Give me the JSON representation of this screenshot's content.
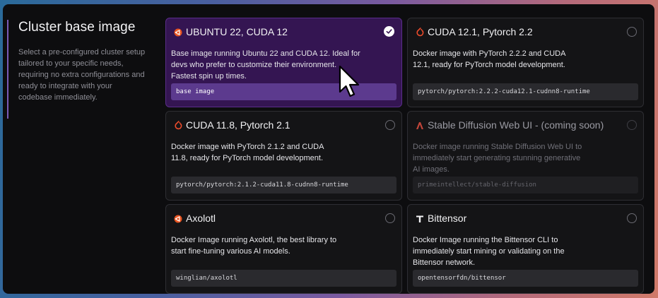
{
  "section": {
    "title": "Cluster base image",
    "description": "Select a pre-configured cluster setup tailored to your specific needs, requiring no extra configurations and ready to integrate with your codebase immediately."
  },
  "cards": [
    {
      "title": "UBUNTU 22, CUDA 12",
      "description": "Base image running Ubuntu 22 and CUDA 12. Ideal for devs who prefer to customize their environment. Fastest spin up times.",
      "tag": "base image",
      "icon": "ubuntu-icon",
      "state": "selected"
    },
    {
      "title": "CUDA 12.1, Pytorch 2.2",
      "description": "Docker image with PyTorch 2.2.2 and CUDA 12.1, ready for PyTorch model development.",
      "tag": "pytorch/pytorch:2.2.2-cuda12.1-cudnn8-runtime",
      "icon": "pytorch-icon",
      "state": "unselected"
    },
    {
      "title": "CUDA 11.8, Pytorch 2.1",
      "description": "Docker image with PyTorch 2.1.2 and CUDA 11.8, ready for PyTorch model development.",
      "tag": "pytorch/pytorch:2.1.2-cuda11.8-cudnn8-runtime",
      "icon": "pytorch-icon",
      "state": "unselected"
    },
    {
      "title": "Stable Diffusion Web UI - (coming soon)",
      "description": "Docker image running Stable Diffusion Web UI to immediately start generating stunning generative AI images.",
      "tag": "primeintellect/stable-diffusion",
      "icon": "stable-diffusion-icon",
      "state": "disabled"
    },
    {
      "title": "Axolotl",
      "description": "Docker Image running Axolotl, the best library to start fine-tuning various AI models.",
      "tag": "winglian/axolotl",
      "icon": "axolotl-icon",
      "state": "unselected"
    },
    {
      "title": "Bittensor",
      "description": "Docker Image running the Bittensor CLI to immediately start mining or validating on the Bittensor network.",
      "tag": "opentensorfdn/bittensor",
      "icon": "bittensor-icon",
      "state": "unselected"
    }
  ],
  "colors": {
    "selected_bg": "#341552",
    "selected_tag": "#5c3a8e",
    "ubuntu_orange": "#e95420",
    "pytorch_red": "#ee4c2c",
    "stable_diffusion_red": "#c0453a"
  }
}
